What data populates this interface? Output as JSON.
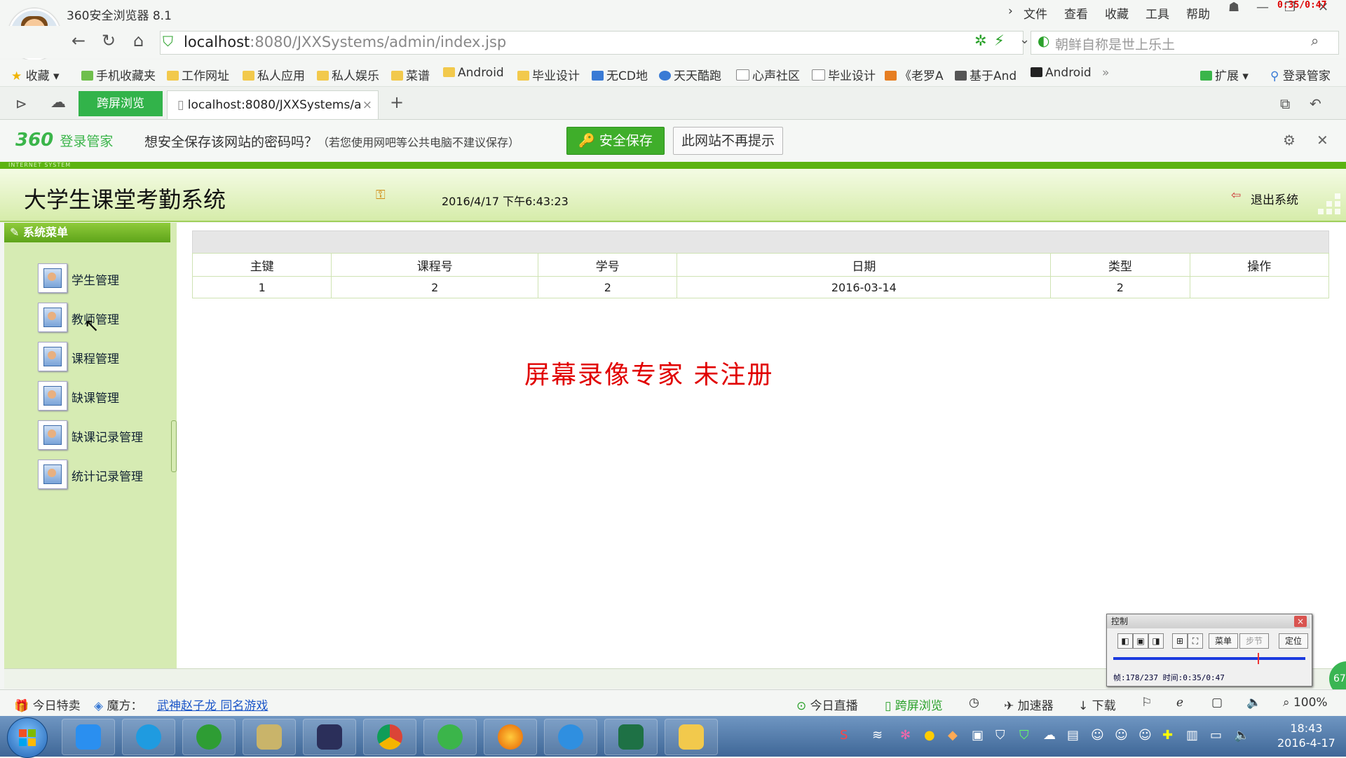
{
  "browser": {
    "title": "360安全浏览器 8.1",
    "menu": [
      "文件",
      "查看",
      "收藏",
      "工具",
      "帮助"
    ],
    "recording_time": "0:35/0:47",
    "url_host": "localhost",
    "url_rest": ":8080/JXXSystems/admin/index.jsp",
    "search_placeholder": "朝鲜自称是世上乐土",
    "bookmarks": [
      "收藏",
      "手机收藏夹",
      "工作网址",
      "私人应用",
      "私人娱乐",
      "菜谱",
      "Android",
      "毕业设计",
      "无CD地",
      "天天酷跑",
      "心声社区",
      "毕业设计",
      "《老罗A",
      "基于And",
      "Android"
    ],
    "bookmarks_right": [
      "扩展",
      "登录管家"
    ],
    "tab_kuaping": "跨屏浏览",
    "tab_active": "localhost:8080/JXXSystems/a",
    "pwbar": {
      "logo": "360",
      "logo_sub": "登录管家",
      "message": "想安全保存该网站的密码吗？",
      "note": "（若您使用网吧等公共电脑不建议保存）",
      "save": "安全保存",
      "never": "此网站不再提示"
    },
    "status": {
      "deal": "今日特卖",
      "mofang": "魔方：",
      "link": "武神赵子龙 同名游戏",
      "live": "今日直播",
      "kuaping": "跨屏浏览",
      "accel": "加速器",
      "download": "下载",
      "zoom": "100%"
    }
  },
  "app": {
    "strip_text": "INTERNET SYSTEM",
    "title": "大学生课堂考勤系统",
    "datetime": "2016/4/17 下午6:43:23",
    "logout": "退出系统",
    "menu_title": "系统菜单",
    "menu": [
      "学生管理",
      "教师管理",
      "课程管理",
      "缺课管理",
      "缺课记录管理",
      "统计记录管理"
    ],
    "table": {
      "headers": [
        "主键",
        "课程号",
        "学号",
        "日期",
        "类型",
        "操作"
      ],
      "rows": [
        [
          "1",
          "2",
          "2",
          "2016-03-14",
          "2",
          ""
        ]
      ]
    },
    "watermark": "屏幕录像专家 未注册"
  },
  "control": {
    "title": "控制",
    "menu": "菜单",
    "step": "步节",
    "locate": "定位",
    "info": "帧:178/237 时间:0:35/0:47",
    "progress": 0.75
  },
  "side_badge": "67",
  "clock": {
    "time": "18:43",
    "date": "2016-4-17"
  }
}
